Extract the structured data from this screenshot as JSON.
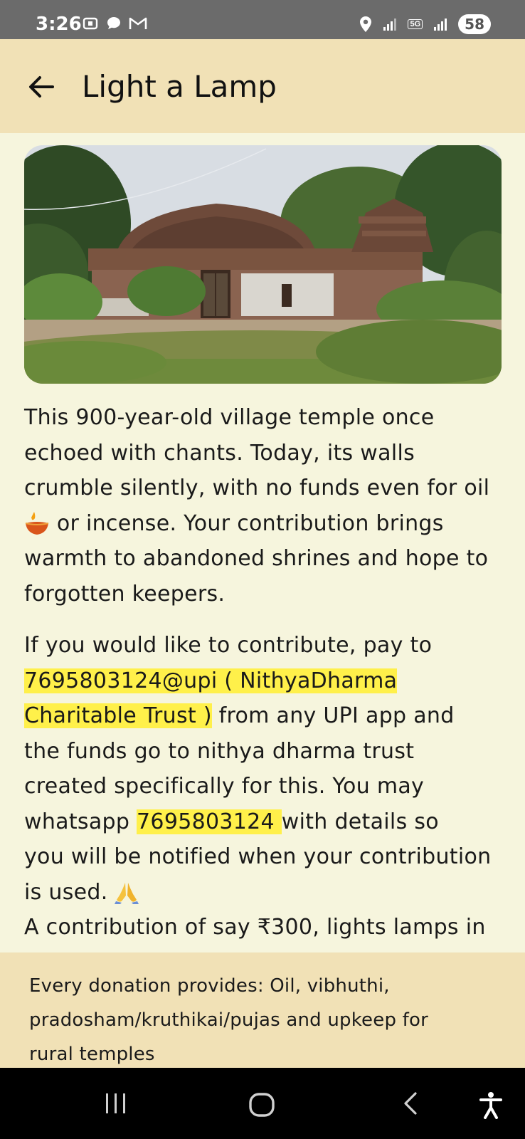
{
  "status_bar": {
    "time": "3:26",
    "battery": "58",
    "network": "5G",
    "icons_left": [
      "screenshot-icon",
      "chat-icon",
      "gmail-icon"
    ],
    "icons_right": [
      "location-icon",
      "signal-icon",
      "signal-icon"
    ]
  },
  "app_bar": {
    "title": "Light a Lamp",
    "back_icon": "arrow-left-icon"
  },
  "description": {
    "line1": "This 900-year-old village temple once",
    "line2": "echoed with chants. Today, its walls",
    "line3": "crumble silently, with no funds even for oil",
    "line4": "or incense. Your contribution brings",
    "line5": "warmth to abandoned shrines and hope to",
    "line6": "forgotten keepers."
  },
  "contribute": {
    "intro": "If you would like to contribute, pay to",
    "upi_id_a": "7695803124@upi ( NithyaDharma",
    "upi_id_b": "Charitable Trust )",
    "after_upi": " from any UPI app and",
    "line3": "the funds go to nithya dharma trust",
    "line4": "created specifically for this. You may",
    "whatsapp_pre": "whatsapp ",
    "whatsapp_number": " 7695803124 ",
    "whatsapp_post": " with details so",
    "line6": "you will be notified when your contribution",
    "line7": "is used.",
    "line8": "A contribution of say ₹300, lights lamps in"
  },
  "footer_banner": {
    "line1": "Every donation provides: Oil, vibhuthi,",
    "line2": "pradosham/kruthikai/pujas and upkeep for",
    "line3": "rural temples"
  },
  "nav": {
    "recents_icon": "recents-icon",
    "home_icon": "home-icon",
    "back_icon": "back-icon",
    "accessibility_icon": "accessibility-icon"
  },
  "colors": {
    "app_bar_bg": "#f1e1b6",
    "content_bg": "#f6f5dd",
    "highlight": "#fff04a"
  }
}
